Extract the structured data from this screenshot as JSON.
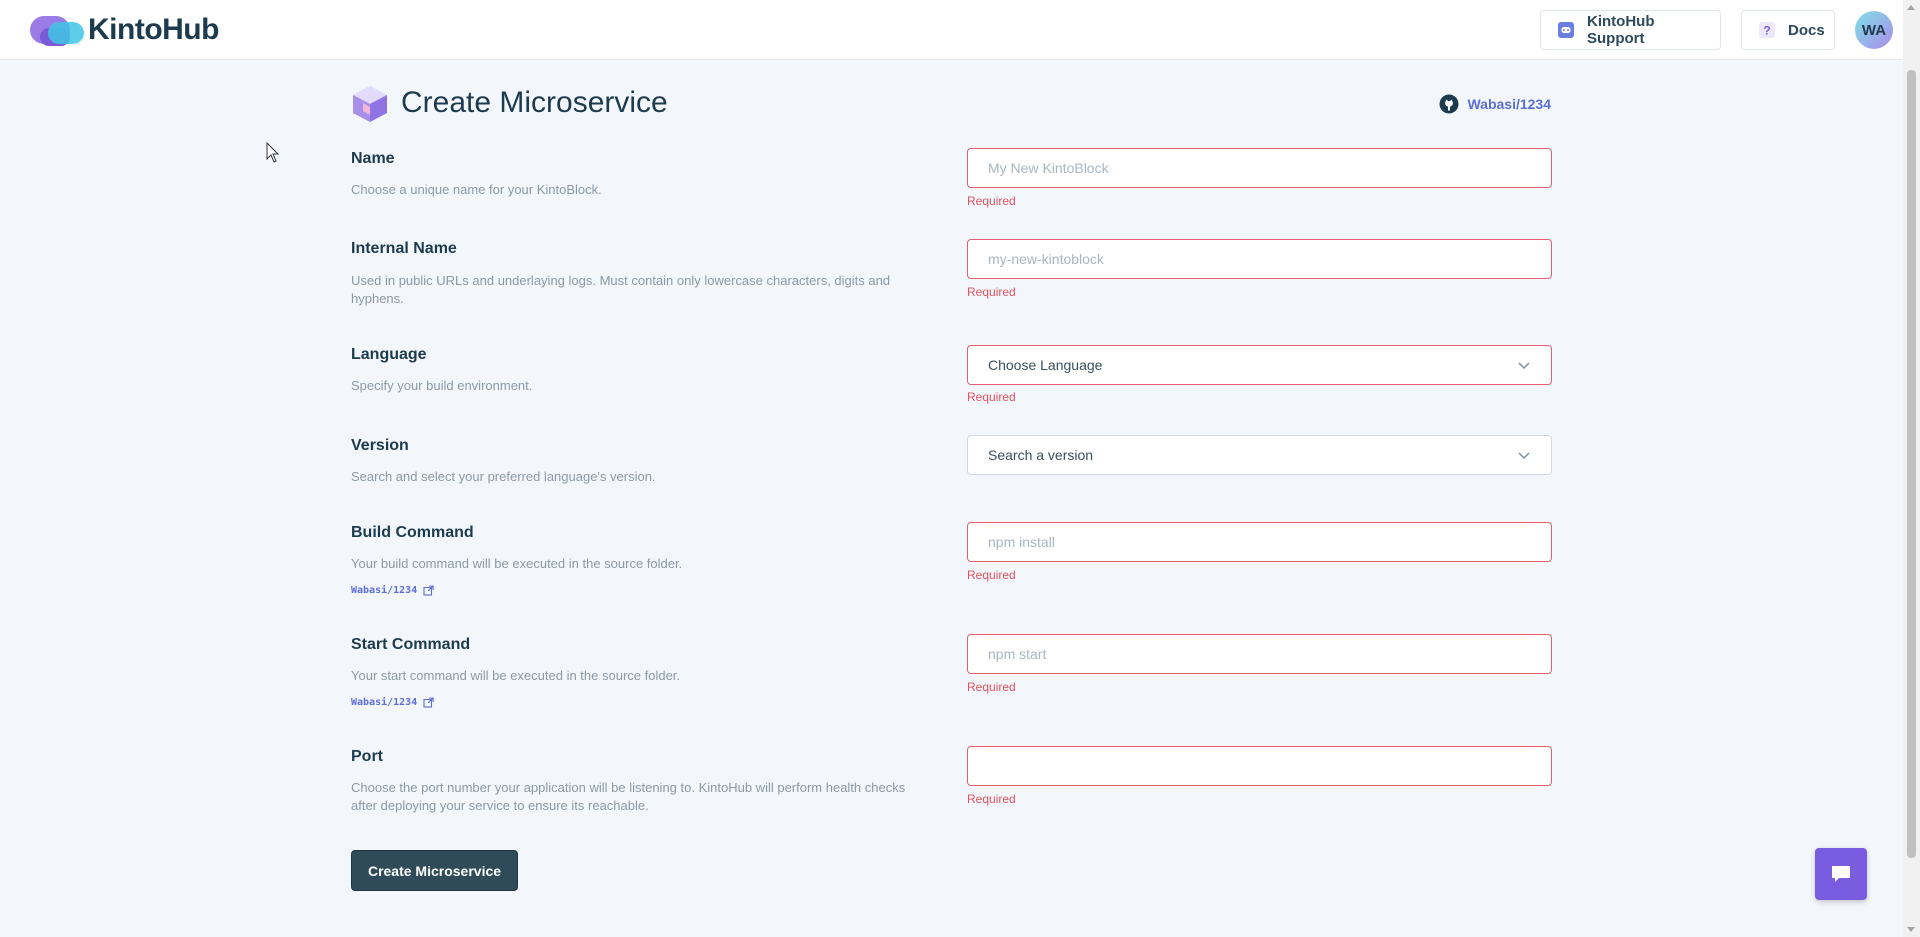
{
  "header": {
    "logo_text": "KintoHub",
    "support_label": "KintoHub Support",
    "docs_label": "Docs",
    "avatar_initials": "WA"
  },
  "page": {
    "title": "Create Microservice",
    "repo_label": "Wabasi/1234"
  },
  "fields": {
    "name": {
      "label": "Name",
      "description": "Choose a unique name for your KintoBlock.",
      "placeholder": "My New KintoBlock",
      "error": "Required"
    },
    "internal_name": {
      "label": "Internal Name",
      "description": "Used in public URLs and underlaying logs. Must contain only lowercase characters, digits and hyphens.",
      "placeholder": "my-new-kintoblock",
      "error": "Required"
    },
    "language": {
      "label": "Language",
      "description": "Specify your build environment.",
      "value": "Choose Language",
      "error": "Required"
    },
    "version": {
      "label": "Version",
      "description": "Search and select your preferred language's version.",
      "value": "Search a version"
    },
    "build_command": {
      "label": "Build Command",
      "description": "Your build command will be executed in the source folder.",
      "repo_link": "Wabasi/1234",
      "placeholder": "npm install",
      "error": "Required"
    },
    "start_command": {
      "label": "Start Command",
      "description": "Your start command will be executed in the source folder.",
      "repo_link": "Wabasi/1234",
      "placeholder": "npm start",
      "error": "Required"
    },
    "port": {
      "label": "Port",
      "description": "Choose the port number your application will be listening to. KintoHub will perform health checks after deploying your service to ensure its reachable.",
      "placeholder": "",
      "error": "Required"
    }
  },
  "submit_label": "Create Microservice",
  "colors": {
    "accent": "#5b6fd6",
    "error": "#e0525d",
    "primary_button": "#2f4a58",
    "chat_button": "#7a5ce0",
    "background": "#f3f7fc"
  }
}
